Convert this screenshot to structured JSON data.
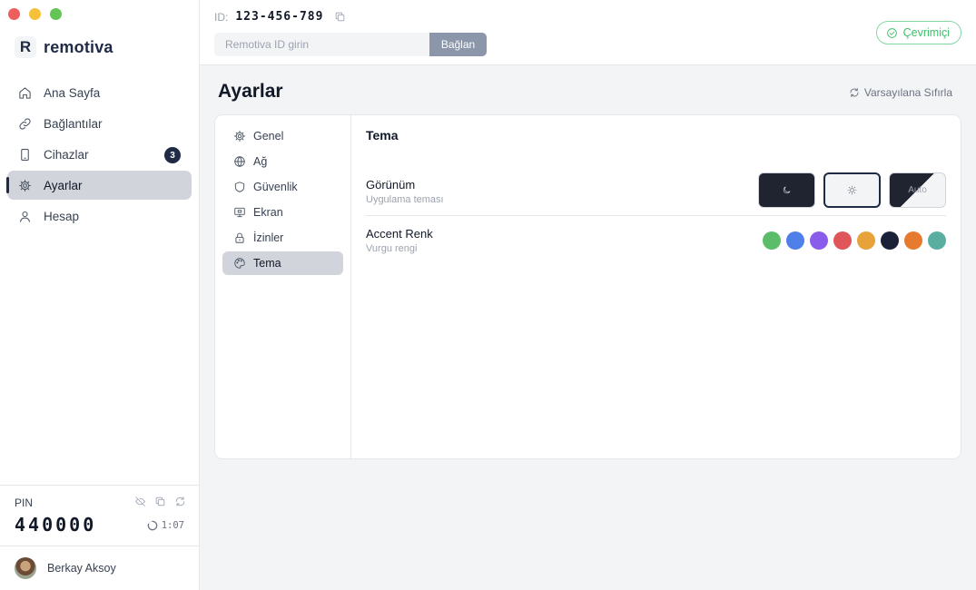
{
  "app": {
    "name": "remotiva",
    "logo_letter": "R"
  },
  "window_controls": {
    "close_color": "#ee5f5b",
    "minimize_color": "#f5c03a",
    "maximize_color": "#62c554"
  },
  "sidebar": {
    "items": [
      {
        "label": "Ana Sayfa",
        "icon": "home-icon"
      },
      {
        "label": "Bağlantılar",
        "icon": "link-icon"
      },
      {
        "label": "Cihazlar",
        "icon": "device-icon",
        "badge": "3"
      },
      {
        "label": "Ayarlar",
        "icon": "gear-icon",
        "active": true
      },
      {
        "label": "Hesap",
        "icon": "user-icon"
      }
    ],
    "pin": {
      "label": "PIN",
      "value": "440000",
      "timer": "1:07"
    },
    "user": {
      "name": "Berkay Aksoy"
    }
  },
  "topbar": {
    "id_label": "ID:",
    "id_value": "123-456-789",
    "connect_placeholder": "Remotiva ID girin",
    "connect_button": "Bağlan",
    "status": "Çevrimiçi"
  },
  "settings": {
    "title": "Ayarlar",
    "reset_label": "Varsayılana Sıfırla",
    "tabs": [
      {
        "label": "Genel",
        "icon": "gear-icon"
      },
      {
        "label": "Ağ",
        "icon": "globe-icon"
      },
      {
        "label": "Güvenlik",
        "icon": "shield-icon"
      },
      {
        "label": "Ekran",
        "icon": "monitor-icon"
      },
      {
        "label": "İzinler",
        "icon": "lock-icon"
      },
      {
        "label": "Tema",
        "icon": "palette-icon",
        "active": true
      }
    ],
    "theme": {
      "section_title": "Tema",
      "appearance": {
        "name": "Görünüm",
        "description": "Uygulama teması",
        "options": [
          {
            "id": "dark",
            "icon": "moon-icon"
          },
          {
            "id": "light",
            "icon": "sun-icon",
            "selected": true
          },
          {
            "id": "auto",
            "label": "Auto"
          }
        ]
      },
      "accent": {
        "name": "Accent Renk",
        "description": "Vurgu rengi",
        "colors": [
          "#5bbd6a",
          "#4f7fe8",
          "#8a5cec",
          "#df555a",
          "#e8a23a",
          "#1b2238",
          "#e67a2e",
          "#5aaea0"
        ]
      }
    }
  }
}
